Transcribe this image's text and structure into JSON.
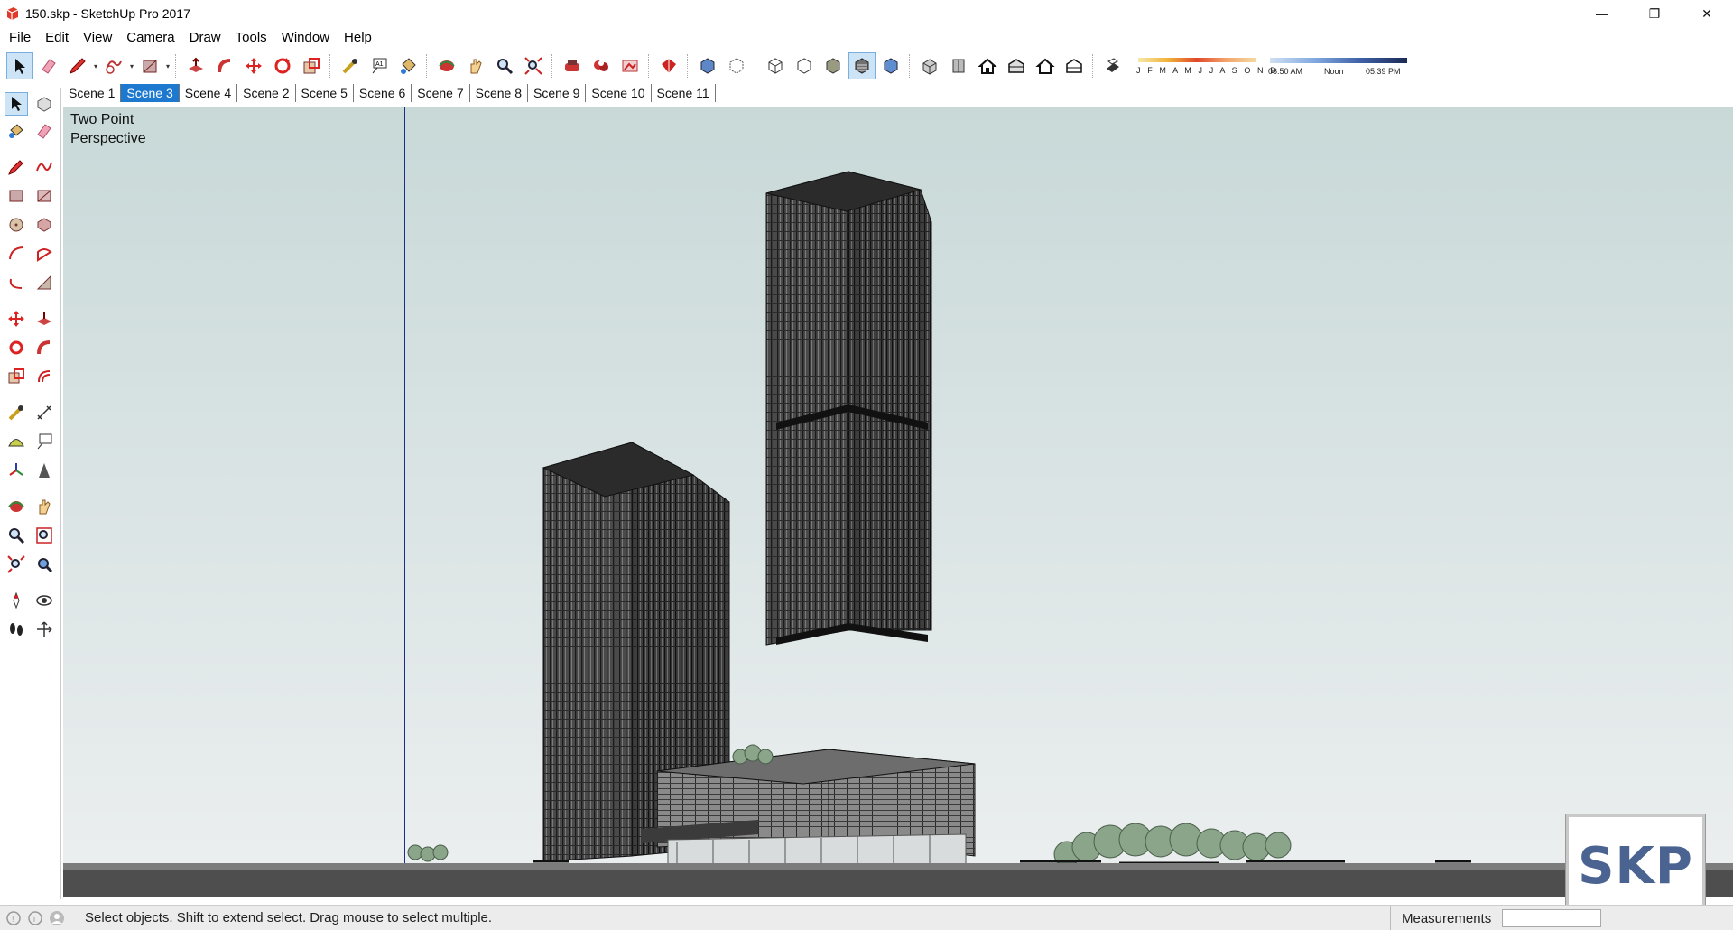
{
  "window": {
    "title": "150.skp - SketchUp Pro 2017",
    "minimize": "—",
    "maximize": "❐",
    "close": "✕"
  },
  "menu": [
    "File",
    "Edit",
    "View",
    "Camera",
    "Draw",
    "Tools",
    "Window",
    "Help"
  ],
  "shadows": {
    "months": "J F M A M J J A S O N D",
    "time_start": "06:50 AM",
    "time_mid": "Noon",
    "time_end": "05:39 PM"
  },
  "scenes": {
    "tabs": [
      "Scene 1",
      "Scene 3",
      "Scene 4",
      "Scene 2",
      "Scene 5",
      "Scene 6",
      "Scene 7",
      "Scene 8",
      "Scene 9",
      "Scene 10",
      "Scene 11"
    ],
    "active": "Scene 3"
  },
  "viewport": {
    "camera_label_line1": "Two Point",
    "camera_label_line2": "Perspective",
    "sky_color": "#c8d9d8",
    "ground_color": "#4e4e4e"
  },
  "watermark": "SKP",
  "status": {
    "hint": "Select objects. Shift to extend select. Drag mouse to select multiple.",
    "measurements_label": "Measurements",
    "measurements_value": ""
  },
  "toolbar_icons": [
    "select-icon",
    "eraser-icon",
    "pencil-icon",
    "shapes-icon",
    "rectangle-icon",
    "push-pull-icon",
    "follow-me-icon",
    "move-icon",
    "rotate-icon",
    "scale-icon",
    "tape-measure-icon",
    "text-icon",
    "paint-bucket-icon",
    "orbit-icon",
    "pan-icon",
    "zoom-icon",
    "zoom-extents-icon",
    "components-icon",
    "warehouse-icon",
    "extension-warehouse-icon",
    "layout-icon",
    "xray-icon",
    "back-edges-icon",
    "wireframe-icon",
    "hidden-line-icon",
    "shaded-icon",
    "textured-icon",
    "monochrome-icon",
    "iso-view-icon",
    "top-view-icon",
    "front-view-icon",
    "right-view-icon",
    "back-view-icon",
    "left-view-icon",
    "shadows-toggle-icon"
  ],
  "accent_color": "#1d79d0"
}
